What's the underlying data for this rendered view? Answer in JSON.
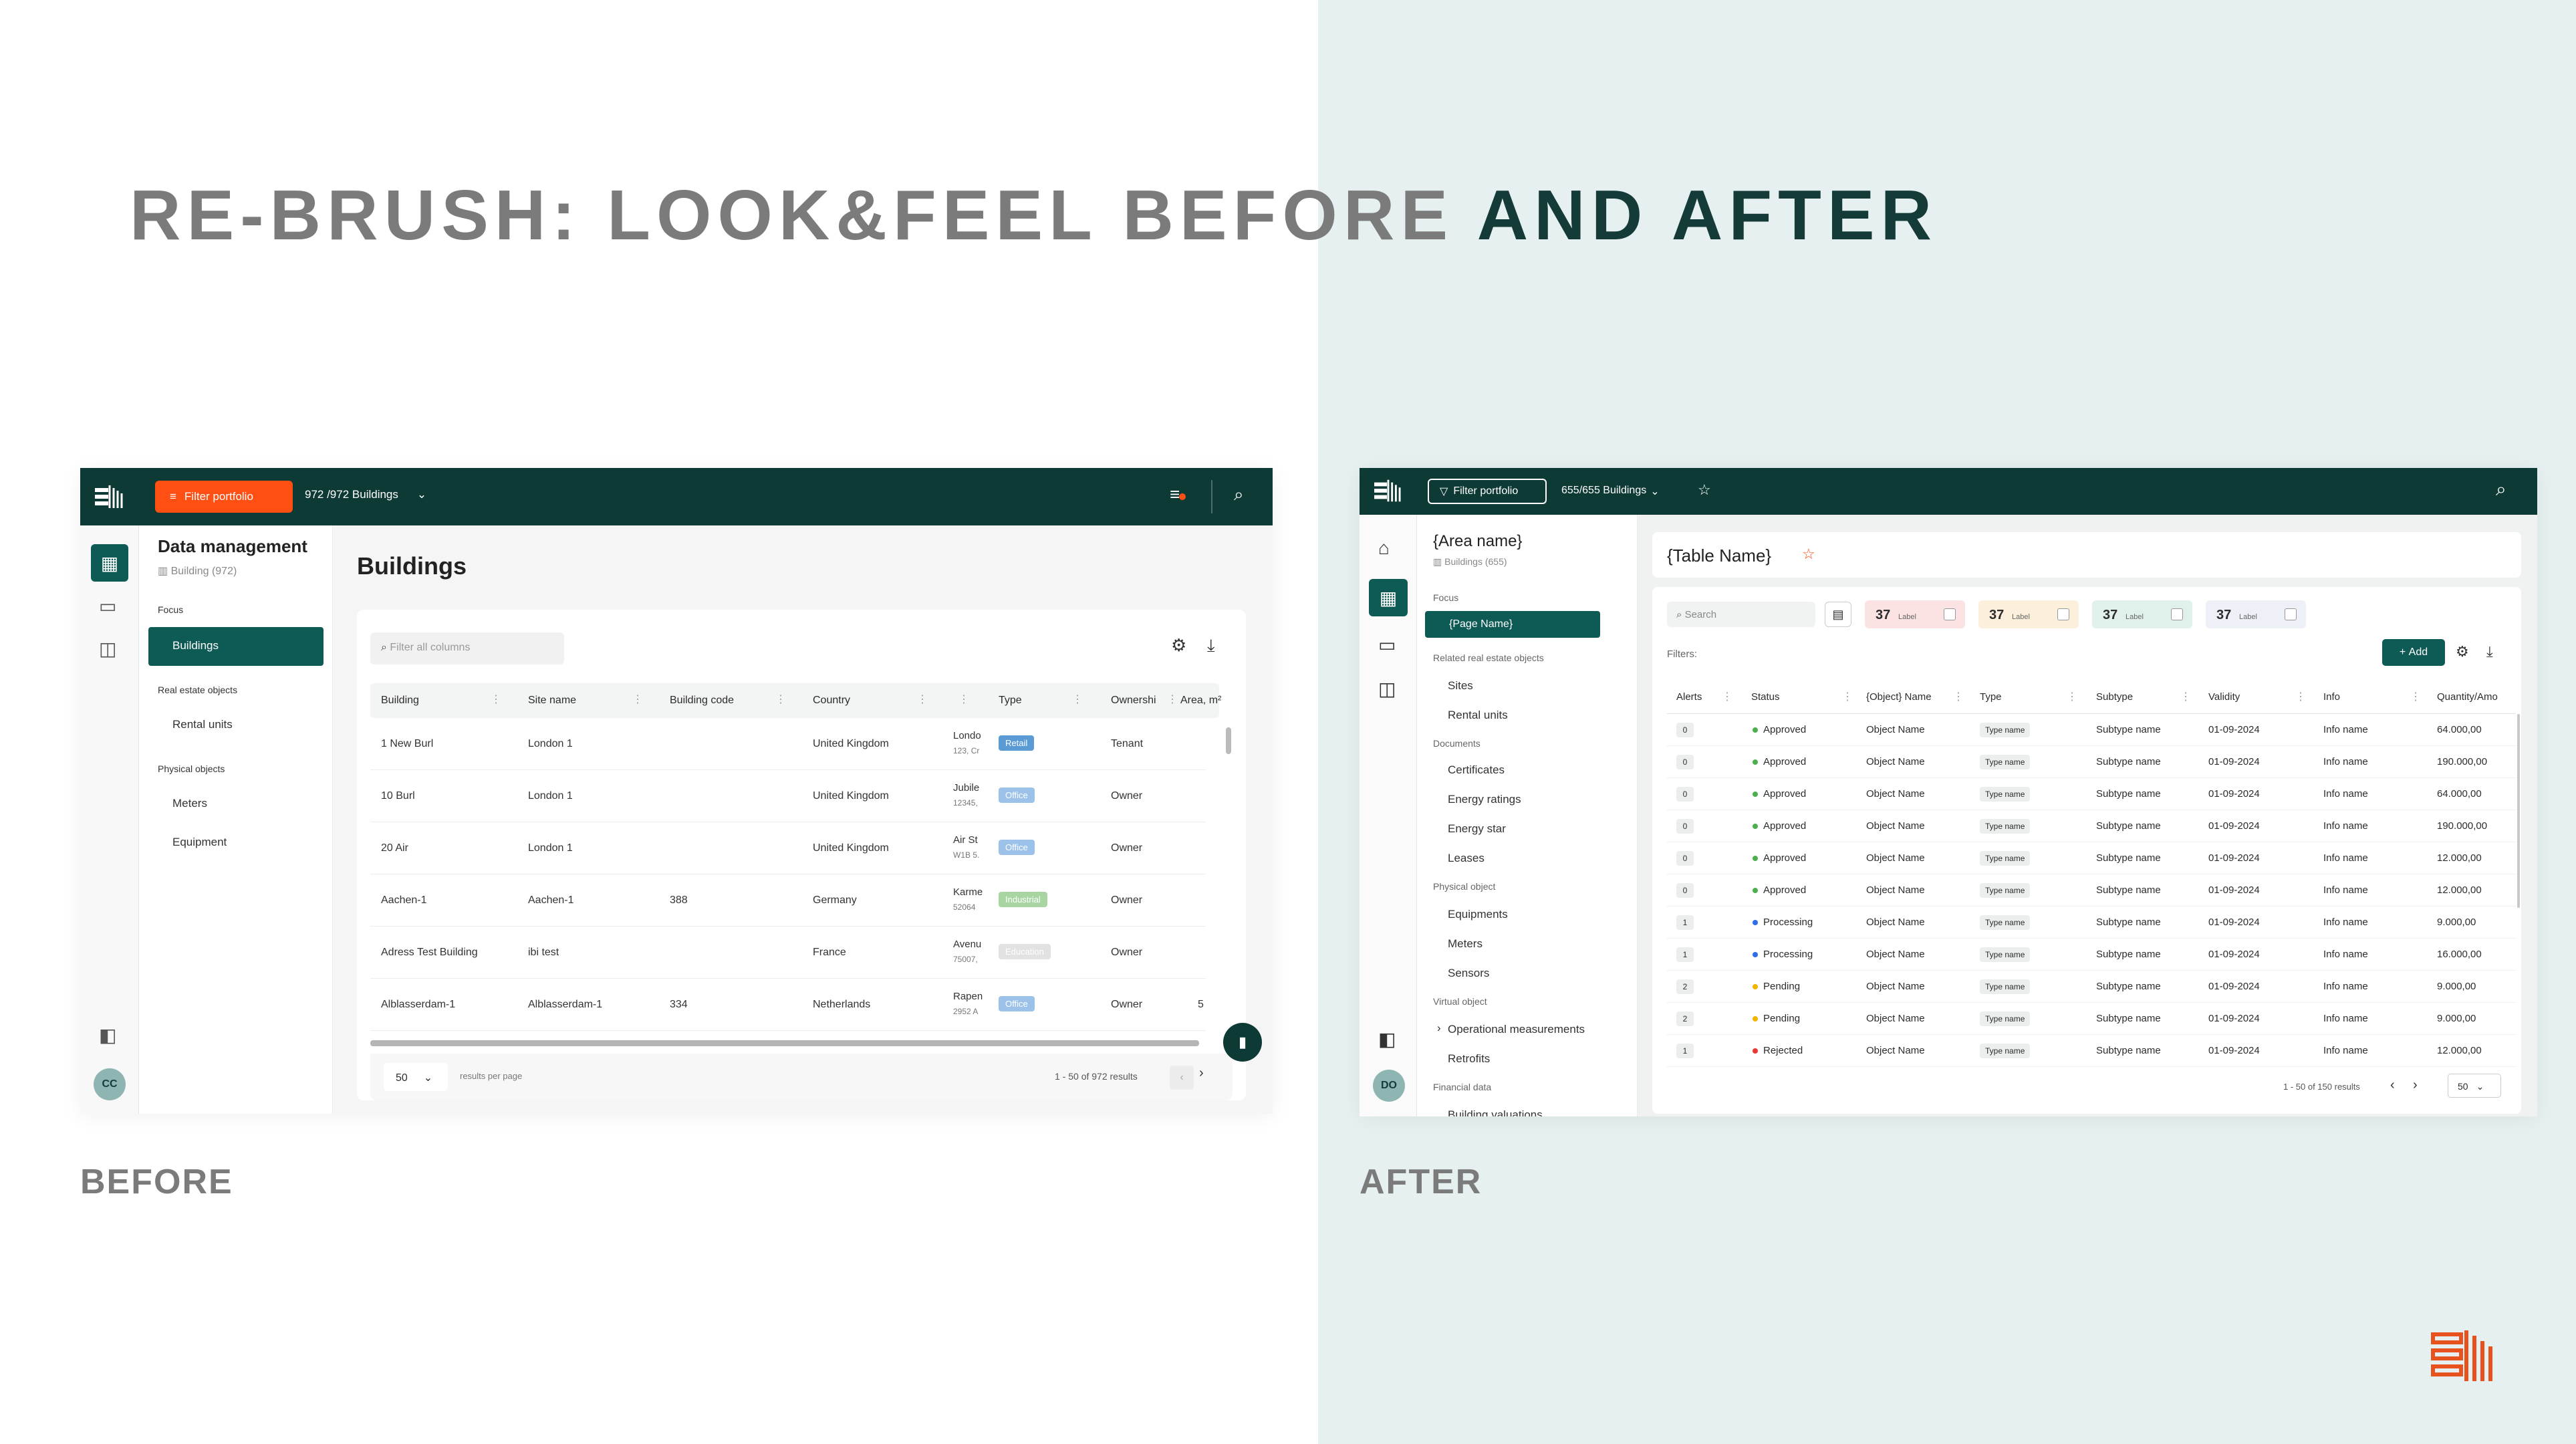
{
  "slide": {
    "title_before": "RE-BRUSH: LOOK&FEEL BEFORE ",
    "title_after": "AND AFTER",
    "caption_before": "BEFORE",
    "caption_after": "AFTER"
  },
  "colors": {
    "dark_teal": "#0e3a36",
    "orange": "#ff4f12",
    "logo_orange": "#e8521e",
    "grey_title": "#7b7b7b",
    "right_bg": "#e7f0f1"
  },
  "before": {
    "topbar": {
      "filter_label": "Filter portfolio",
      "building_count": "972 /972 Buildings"
    },
    "user_initials": "CC",
    "nav": {
      "title": "Data management",
      "subtitle": "Building (972)",
      "sections": [
        {
          "label": "Focus",
          "items": [
            "Buildings"
          ]
        },
        {
          "label": "Real estate objects",
          "items": [
            "Rental units"
          ]
        },
        {
          "label": "Physical objects",
          "items": [
            "Meters",
            "Equipment"
          ]
        }
      ]
    },
    "page_title": "Buildings",
    "search_placeholder": "Filter all columns",
    "columns": [
      "Building",
      "Site name",
      "Building code",
      "Country",
      "",
      "Type",
      "Ownershi",
      "Area, m²"
    ],
    "rows": [
      {
        "building": "1 New Burl",
        "site": "London 1",
        "code": "",
        "country": "United Kingdom",
        "addr1": "Londo",
        "addr2": "123, Cr",
        "type": "Retail",
        "type_color": "#5b9bd5",
        "own": "Tenant",
        "area": ""
      },
      {
        "building": "10 Burl",
        "site": "London 1",
        "code": "",
        "country": "United Kingdom",
        "addr1": "Jubile",
        "addr2": "12345,",
        "type": "Office",
        "type_color": "#9cc2ea",
        "own": "Owner",
        "area": ""
      },
      {
        "building": "20 Air",
        "site": "London 1",
        "code": "",
        "country": "United Kingdom",
        "addr1": "Air St",
        "addr2": "W1B 5.",
        "type": "Office",
        "type_color": "#9cc2ea",
        "own": "Owner",
        "area": ""
      },
      {
        "building": "Aachen-1",
        "site": "Aachen-1",
        "code": "388",
        "country": "Germany",
        "addr1": "Karme",
        "addr2": "52064",
        "type": "Industrial",
        "type_color": "#a8d5a2",
        "own": "Owner",
        "area": ""
      },
      {
        "building": "Adress Test Building",
        "site": "ibi test",
        "code": "",
        "country": "France",
        "addr1": "Avenu",
        "addr2": "75007,",
        "type": "Education",
        "type_color": "#e2e2e2",
        "own": "Owner",
        "area": ""
      },
      {
        "building": "Alblasserdam-1",
        "site": "Alblasserdam-1",
        "code": "334",
        "country": "Netherlands",
        "addr1": "Rapen",
        "addr2": "2952 A",
        "type": "Office",
        "type_color": "#9cc2ea",
        "own": "Owner",
        "area": "5"
      }
    ],
    "footer": {
      "per_page": "50",
      "per_page_label": "results per page",
      "range": "1 - 50 of 972 results"
    }
  },
  "after": {
    "topbar": {
      "filter_label": "Filter portfolio",
      "building_count": "655/655 Buildings"
    },
    "user_initials": "DO",
    "nav": {
      "title": "{Area name}",
      "subtitle": "Buildings (655)",
      "sections": [
        {
          "label": "Focus",
          "items": [
            "{Page Name}"
          ]
        },
        {
          "label": "Related real estate objects",
          "items": [
            "Sites",
            "Rental units"
          ]
        },
        {
          "label": "Documents",
          "items": [
            "Certificates",
            "Energy ratings",
            "Energy star",
            "Leases"
          ]
        },
        {
          "label": "Physical object",
          "items": [
            "Equipments",
            "Meters",
            "Sensors"
          ]
        },
        {
          "label": "Virtual object",
          "items": [
            "Operational measurements",
            "Retrofits"
          ]
        },
        {
          "label": "Financial data",
          "items": [
            "Building valuations"
          ]
        }
      ]
    },
    "table_name": "{Table Name}",
    "search_placeholder": "Search",
    "kpis": [
      {
        "value": "37",
        "label": "Label",
        "color": "#fbe3e3"
      },
      {
        "value": "37",
        "label": "Label",
        "color": "#fcefdc"
      },
      {
        "value": "37",
        "label": "Label",
        "color": "#e0f1ec"
      },
      {
        "value": "37",
        "label": "Label",
        "color": "#eef0f7"
      }
    ],
    "filters_label": "Filters:",
    "add_label": "Add",
    "columns": [
      "Alerts",
      "Status",
      "{Object} Name",
      "Type",
      "Subtype",
      "Validity",
      "Info",
      "Quantity/Amo"
    ],
    "rows": [
      {
        "alerts": "0",
        "status": "Approved",
        "dot": "#4caf50",
        "name": "Object Name",
        "type": "Type name",
        "subtype": "Subtype name",
        "validity": "01-09-2024",
        "info": "Info name",
        "qty": "64.000,00"
      },
      {
        "alerts": "0",
        "status": "Approved",
        "dot": "#4caf50",
        "name": "Object Name",
        "type": "Type name",
        "subtype": "Subtype name",
        "validity": "01-09-2024",
        "info": "Info name",
        "qty": "190.000,00"
      },
      {
        "alerts": "0",
        "status": "Approved",
        "dot": "#4caf50",
        "name": "Object Name",
        "type": "Type name",
        "subtype": "Subtype name",
        "validity": "01-09-2024",
        "info": "Info name",
        "qty": "64.000,00"
      },
      {
        "alerts": "0",
        "status": "Approved",
        "dot": "#4caf50",
        "name": "Object Name",
        "type": "Type name",
        "subtype": "Subtype name",
        "validity": "01-09-2024",
        "info": "Info name",
        "qty": "190.000,00"
      },
      {
        "alerts": "0",
        "status": "Approved",
        "dot": "#4caf50",
        "name": "Object Name",
        "type": "Type name",
        "subtype": "Subtype name",
        "validity": "01-09-2024",
        "info": "Info name",
        "qty": "12.000,00"
      },
      {
        "alerts": "0",
        "status": "Approved",
        "dot": "#4caf50",
        "name": "Object Name",
        "type": "Type name",
        "subtype": "Subtype name",
        "validity": "01-09-2024",
        "info": "Info name",
        "qty": "12.000,00"
      },
      {
        "alerts": "1",
        "status": "Processing",
        "dot": "#2f6fe4",
        "name": "Object Name",
        "type": "Type name",
        "subtype": "Subtype name",
        "validity": "01-09-2024",
        "info": "Info name",
        "qty": "9.000,00"
      },
      {
        "alerts": "1",
        "status": "Processing",
        "dot": "#2f6fe4",
        "name": "Object Name",
        "type": "Type name",
        "subtype": "Subtype name",
        "validity": "01-09-2024",
        "info": "Info name",
        "qty": "16.000,00"
      },
      {
        "alerts": "2",
        "status": "Pending",
        "dot": "#f5b400",
        "name": "Object Name",
        "type": "Type name",
        "subtype": "Subtype name",
        "validity": "01-09-2024",
        "info": "Info name",
        "qty": "9.000,00"
      },
      {
        "alerts": "2",
        "status": "Pending",
        "dot": "#f5b400",
        "name": "Object Name",
        "type": "Type name",
        "subtype": "Subtype name",
        "validity": "01-09-2024",
        "info": "Info name",
        "qty": "9.000,00"
      },
      {
        "alerts": "1",
        "status": "Rejected",
        "dot": "#e53935",
        "name": "Object Name",
        "type": "Type name",
        "subtype": "Subtype name",
        "validity": "01-09-2024",
        "info": "Info name",
        "qty": "12.000,00"
      }
    ],
    "footer": {
      "range": "1 - 50 of 150 results",
      "per_page": "50"
    }
  }
}
